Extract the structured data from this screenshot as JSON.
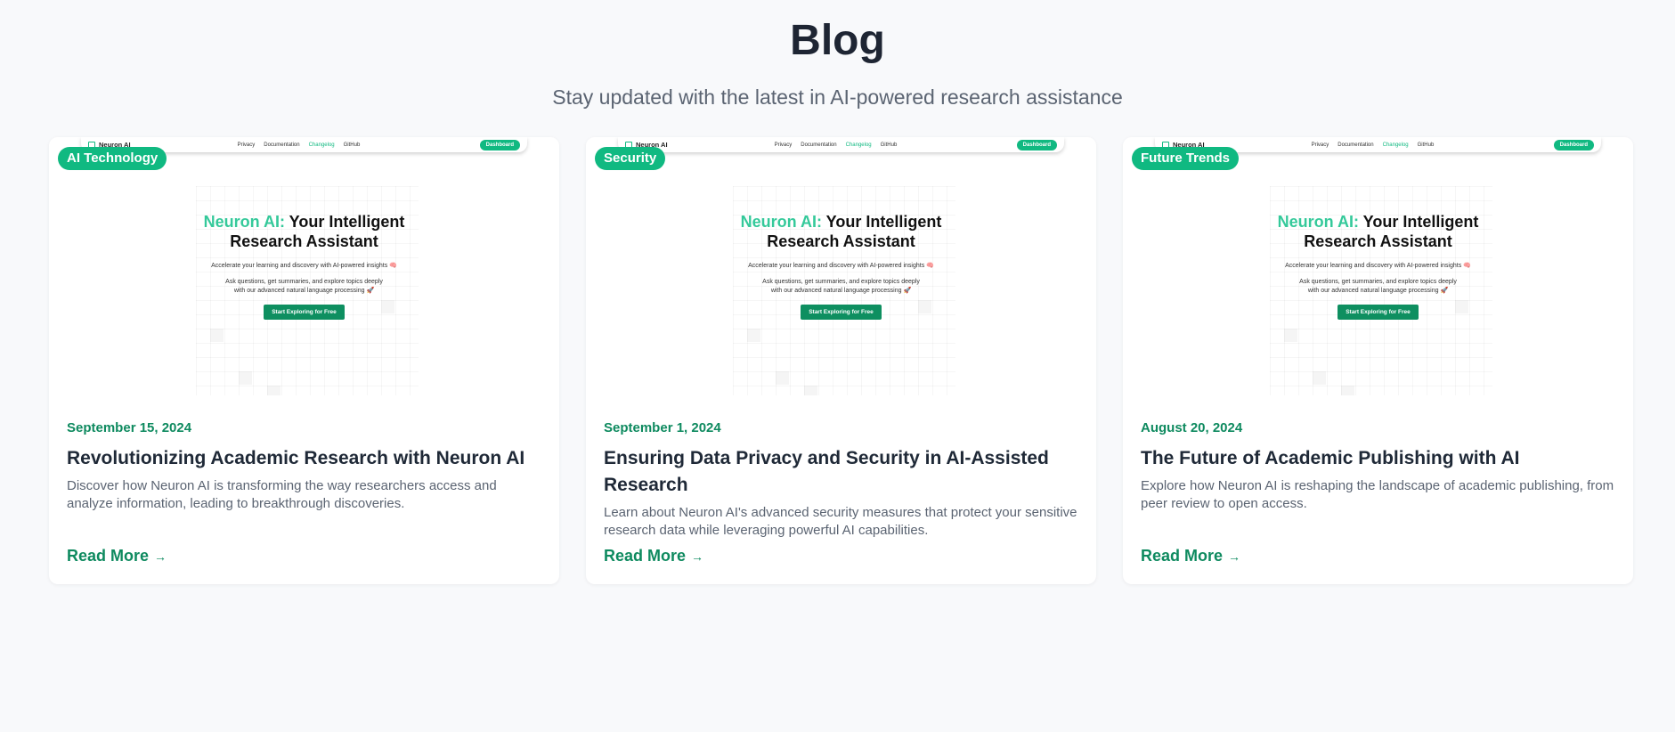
{
  "header": {
    "title": "Blog",
    "subtitle": "Stay updated with the latest in AI-powered research assistance"
  },
  "thumbnail": {
    "nav_logo": "Neuron AI",
    "nav_links": [
      "Privacy",
      "Documentation",
      "Changelog",
      "GitHub"
    ],
    "nav_button": "Dashboard",
    "hero_accent": "Neuron AI:",
    "hero_title": "Your Intelligent",
    "hero_title2": "Research Assistant",
    "hero_sub": "Accelerate your learning and discovery with AI-powered insights 🧠",
    "hero_sub2": "Ask questions, get summaries, and explore topics deeply with our advanced natural language processing 🚀",
    "hero_cta": "Start Exploring for Free"
  },
  "posts": [
    {
      "category": "AI Technology",
      "date": "September 15, 2024",
      "title": "Revolutionizing Academic Research with Neuron AI",
      "excerpt": "Discover how Neuron AI is transforming the way researchers access and analyze information, leading to breakthrough discoveries.",
      "link": "Read More"
    },
    {
      "category": "Security",
      "date": "September 1, 2024",
      "title": "Ensuring Data Privacy and Security in AI-Assisted Research",
      "excerpt": "Learn about Neuron AI's advanced security measures that protect your sensitive research data while leveraging powerful AI capabilities.",
      "link": "Read More"
    },
    {
      "category": "Future Trends",
      "date": "August 20, 2024",
      "title": "The Future of Academic Publishing with AI",
      "excerpt": "Explore how Neuron AI is reshaping the landscape of academic publishing, from peer review to open access.",
      "link": "Read More"
    }
  ],
  "colors": {
    "accent": "#10b981",
    "link": "#0e8a5f",
    "background": "#f8f9fb"
  }
}
